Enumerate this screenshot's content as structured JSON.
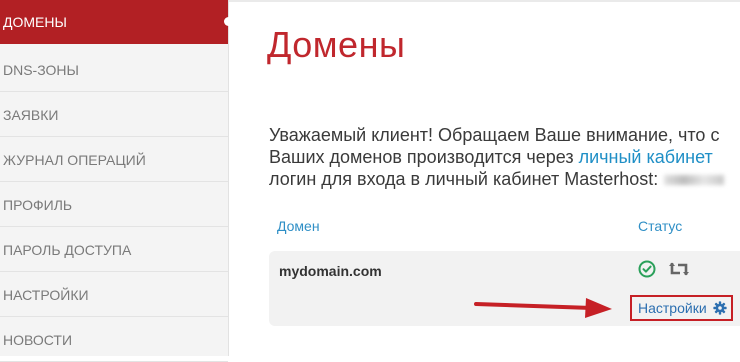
{
  "sidebar": {
    "items": [
      {
        "label": "ДОМЕНЫ",
        "active": true
      },
      {
        "label": "DNS-ЗОНЫ"
      },
      {
        "label": "ЗАЯВКИ"
      },
      {
        "label": "ЖУРНАЛ ОПЕРАЦИЙ"
      },
      {
        "label": "ПРОФИЛЬ"
      },
      {
        "label": "ПАРОЛЬ ДОСТУПА"
      },
      {
        "label": "НАСТРОЙКИ"
      },
      {
        "label": "НОВОСТИ"
      }
    ]
  },
  "main": {
    "title": "Домены",
    "notice": {
      "line1": "Уважаемый клиент! Обращаем Ваше внимание, что с",
      "line2_prefix": "Ваших доменов производится через ",
      "line2_link": "личный кабинет",
      "line3": "логин для входа в личный кабинет Masterhost:"
    },
    "table": {
      "col_domain": "Домен",
      "col_status": "Статус",
      "rows": [
        {
          "domain": "mydomain.com",
          "settings_label": "Настройки"
        }
      ]
    }
  },
  "colors": {
    "accent_red": "#b22024",
    "title_red": "#c0272d",
    "link_blue": "#1f8fc6",
    "status_green": "#2aa05a"
  },
  "icons": {
    "status": "check-circle-icon",
    "renew": "retweet-icon",
    "settings": "gear-icon",
    "annotation": "red-arrow-icon"
  }
}
